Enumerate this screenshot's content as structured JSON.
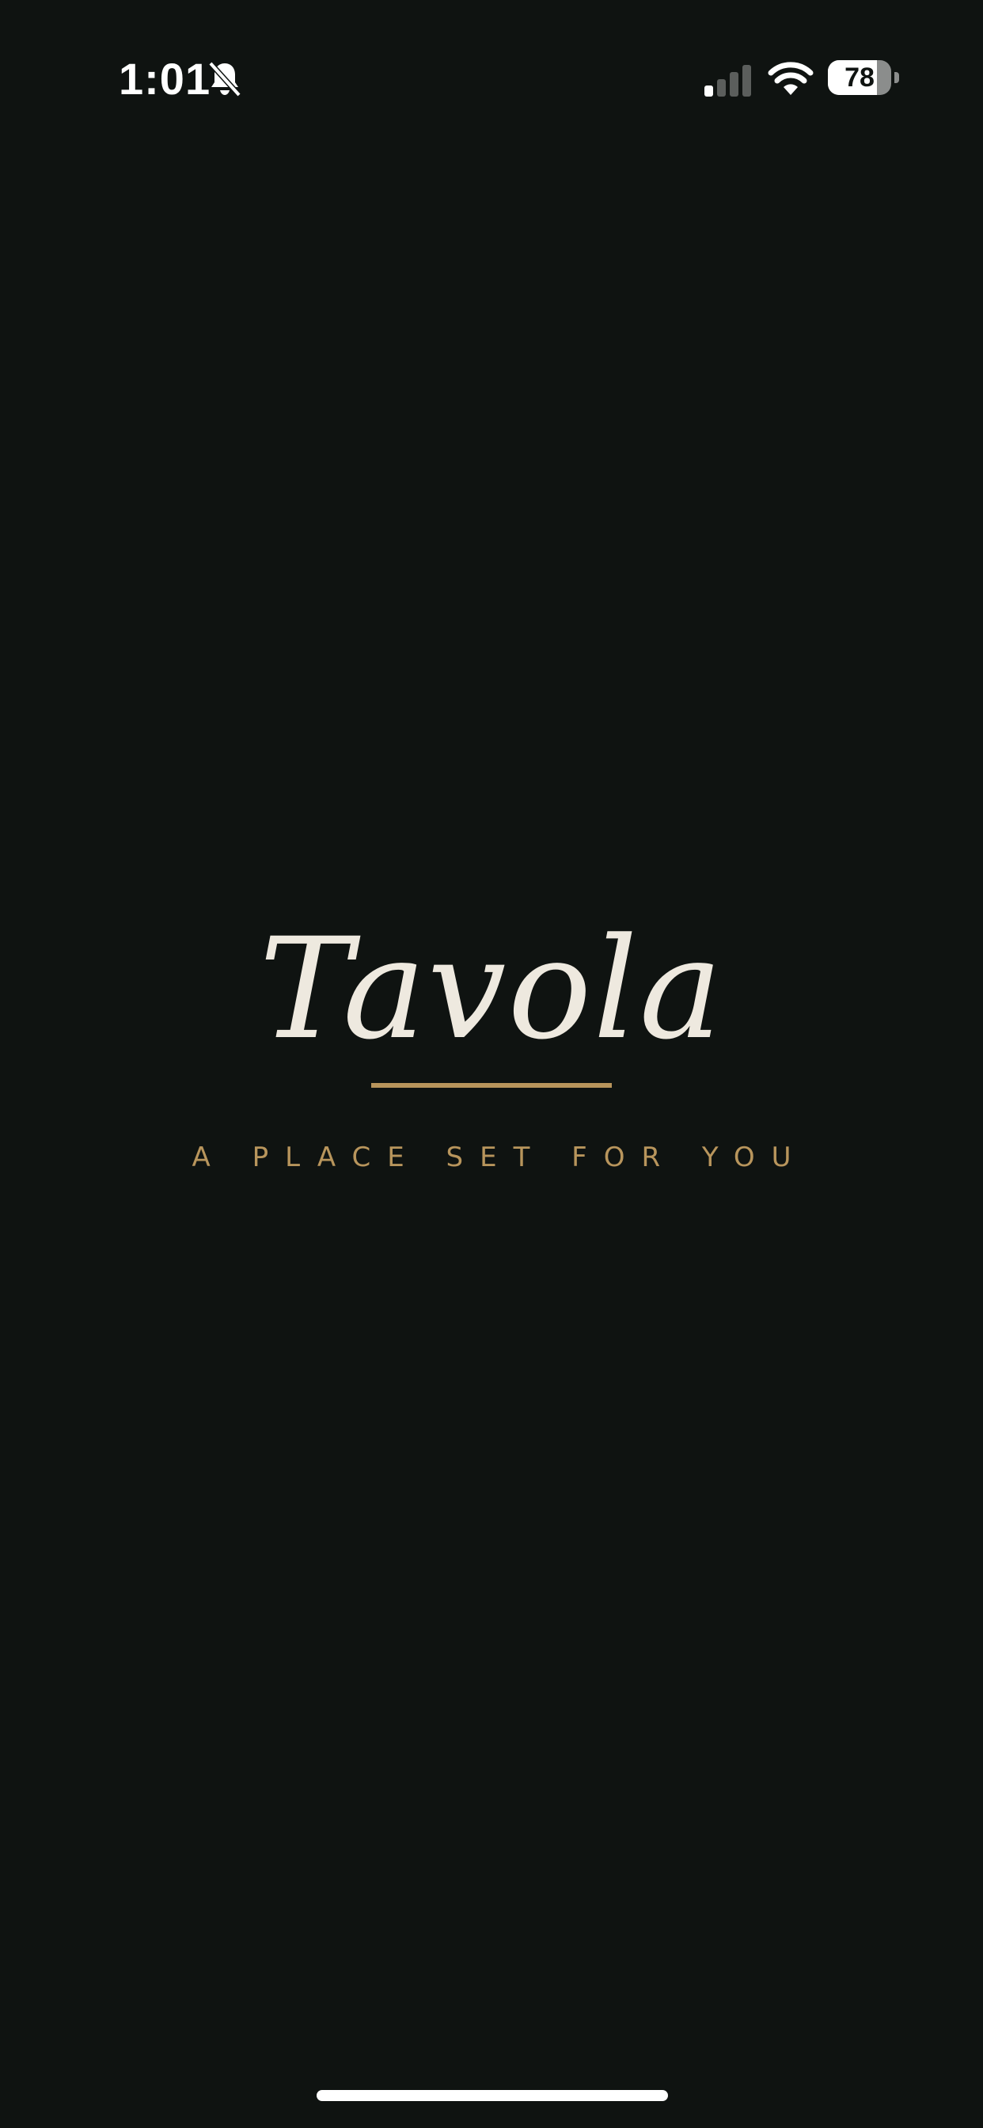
{
  "status_bar": {
    "time": "1:01",
    "battery_level": "78",
    "battery_fraction": 0.78,
    "icons": [
      "bell-slash-icon",
      "cellular-signal-icon",
      "wifi-icon",
      "battery-icon"
    ]
  },
  "brand": {
    "name": "Tavola",
    "tagline": "A PLACE SET FOR YOU"
  },
  "colors": {
    "background": "#0f1311",
    "title": "#eee9df",
    "accent": "#b8955c"
  }
}
